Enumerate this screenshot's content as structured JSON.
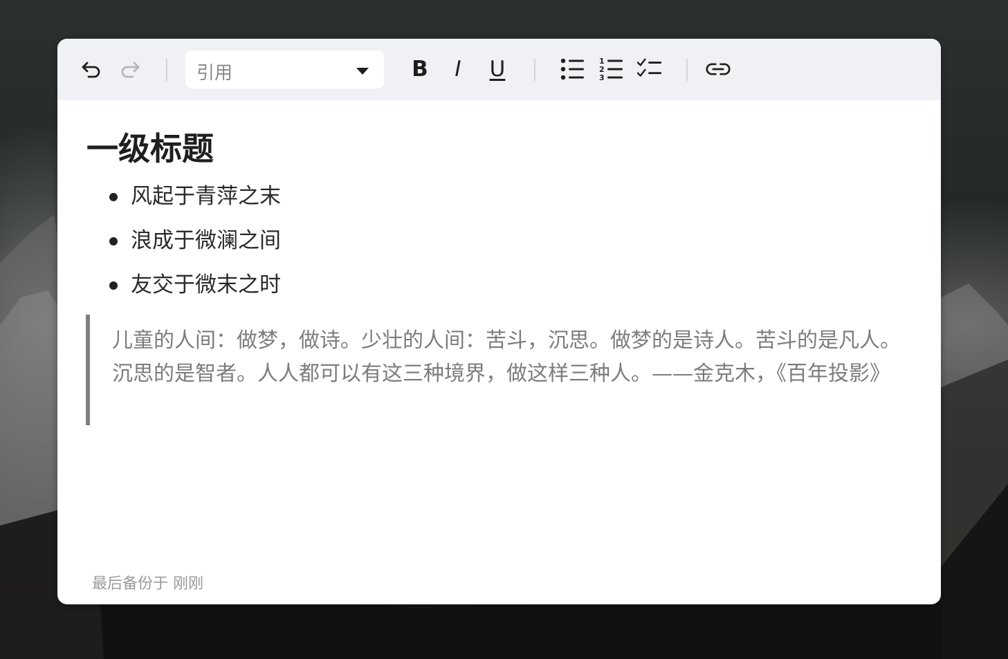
{
  "toolbar": {
    "block_style": "引用",
    "bold_label": "B",
    "italic_label": "I",
    "underline_label": "U",
    "icons": {
      "undo": "undo-icon",
      "redo": "redo-icon",
      "dropdown": "chevron-down-icon",
      "bullet_list": "bullet-list-icon",
      "ordered_list": "ordered-list-icon",
      "task_list": "task-list-icon",
      "link": "link-icon"
    },
    "redo_enabled": false
  },
  "document": {
    "heading": "一级标题",
    "bullets": [
      "风起于青萍之末",
      "浪成于微澜之间",
      "友交于微末之时"
    ],
    "quote": "儿童的人间：做梦，做诗。少壮的人间：苦斗，沉思。做梦的是诗人。苦斗的是凡人。沉思的是智者。人人都可以有这三种境界，做这样三种人。——金克木，《百年投影》"
  },
  "status": {
    "backup_text": "最后备份于 刚刚"
  },
  "colors": {
    "toolbar_bg": "#f0f1f4",
    "text": "#1e1e1e",
    "quote_text": "#7c7c7c",
    "quote_bar": "#7f7f7f",
    "muted": "#9a9a9a"
  }
}
